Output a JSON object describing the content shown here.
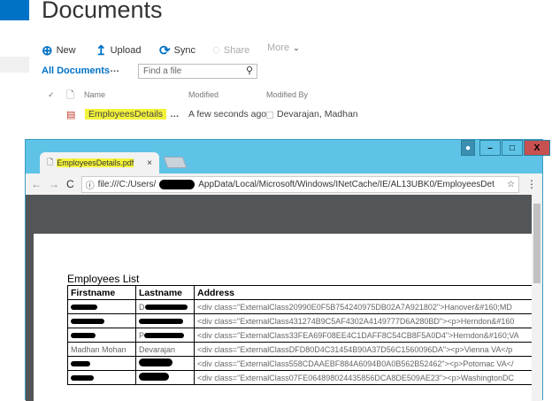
{
  "sharepoint": {
    "title": "Documents",
    "toolbar": [
      {
        "label": "New",
        "icon": "plus-circle-icon"
      },
      {
        "label": "Upload",
        "icon": "upload-icon"
      },
      {
        "label": "Sync",
        "icon": "sync-icon"
      },
      {
        "label": "Share",
        "icon": "share-icon"
      },
      {
        "label": "More",
        "icon": "chevron-down-icon"
      }
    ],
    "view": "All Documents",
    "ellipsis": "…",
    "search_placeholder": "Find a file",
    "columns": {
      "name": "Name",
      "modified": "Modified",
      "modified_by": "Modified By"
    },
    "files": [
      {
        "name": "EmployeesDetails",
        "modified": "A few seconds ago",
        "modified_by": "Devarajan, Madhan"
      }
    ]
  },
  "browser": {
    "tab_title": "EmployeesDetails.pdf",
    "url_prefix": "file:///C:/Users/",
    "url_suffix": "AppData/Local/Microsoft/Windows/INetCache/IE/AL13UBK0/EmployeesDet",
    "controls": {
      "min": "–",
      "max": "□",
      "close": "X"
    }
  },
  "pdf": {
    "title": "Employees List",
    "headers": [
      "Firstname",
      "Lastname",
      "Address"
    ],
    "rows": [
      [
        "",
        "D",
        "<div class=\"ExternalClass20990E0F5B754240975DB02A7A921802\">Hanover&#160;MD"
      ],
      [
        "",
        "",
        "<div class=\"ExternalClass431274B9C5AF4302A4149777D6A280BD\"><p>Herndon&#160"
      ],
      [
        "",
        "P",
        "<div class=\"ExternalClass33FEA69F08EE4C1DAFF8C54CB8F5A0D4\">Herndon&#160;VA"
      ],
      [
        "Madhan Mohan",
        "Devarajan",
        "<div class=\"ExternalClassDFD80D4C31454B90A37D56C1560096DA\"><p>Vienna VA</p"
      ],
      [
        "",
        "",
        "<div class=\"ExternalClass558CDAAEBF884A6094B0A0B562B52462\"><p>Potomac VA</"
      ],
      [
        "",
        "",
        "<div class=\"ExternalClass07FE064898024435856DCA8DE509AE23\"><p>WashingtonDC"
      ]
    ]
  }
}
